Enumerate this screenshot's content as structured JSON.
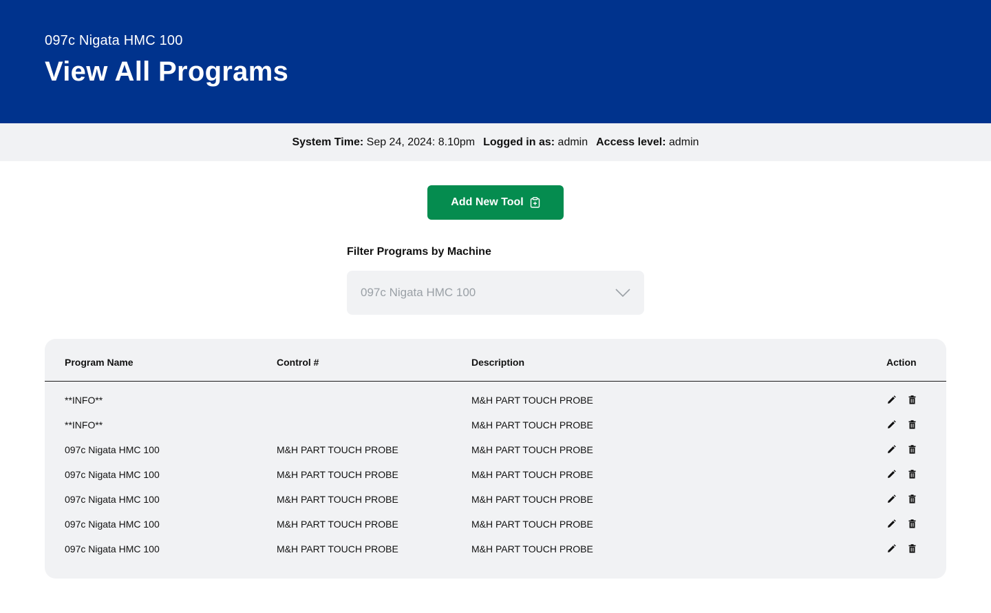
{
  "header": {
    "machine": "097c Nigata HMC 100",
    "title": "View All Programs",
    "background": "#00338d"
  },
  "status": {
    "system_time_label": "System Time:",
    "system_time_value": "Sep 24, 2024: 8.10pm",
    "logged_in_label": "Logged in as:",
    "logged_in_value": "admin",
    "access_label": "Access level:",
    "access_value": "admin"
  },
  "add_button": {
    "label": "Add New Tool",
    "icon": "clipboard-plus-icon",
    "color": "#058c4f"
  },
  "filter": {
    "label": "Filter Programs by Machine",
    "selected": "097c Nigata HMC 100",
    "icon": "chevron-down-icon"
  },
  "table": {
    "columns": [
      "Program Name",
      "Control #",
      "Description",
      "Action"
    ],
    "rows": [
      {
        "name": "**INFO**",
        "control": "",
        "description": "M&H PART TOUCH PROBE"
      },
      {
        "name": "**INFO**",
        "control": "",
        "description": "M&H PART TOUCH PROBE"
      },
      {
        "name": "097c Nigata HMC 100",
        "control": "M&H PART TOUCH PROBE",
        "description": "M&H PART TOUCH PROBE"
      },
      {
        "name": "097c Nigata HMC 100",
        "control": "M&H PART TOUCH PROBE",
        "description": "M&H PART TOUCH PROBE"
      },
      {
        "name": "097c Nigata HMC 100",
        "control": "M&H PART TOUCH PROBE",
        "description": "M&H PART TOUCH PROBE"
      },
      {
        "name": "097c Nigata HMC 100",
        "control": "M&H PART TOUCH PROBE",
        "description": "M&H PART TOUCH PROBE"
      },
      {
        "name": "097c Nigata HMC 100",
        "control": "M&H PART TOUCH PROBE",
        "description": "M&H PART TOUCH PROBE"
      }
    ],
    "row_actions": [
      "pencil-icon",
      "trash-icon"
    ]
  }
}
